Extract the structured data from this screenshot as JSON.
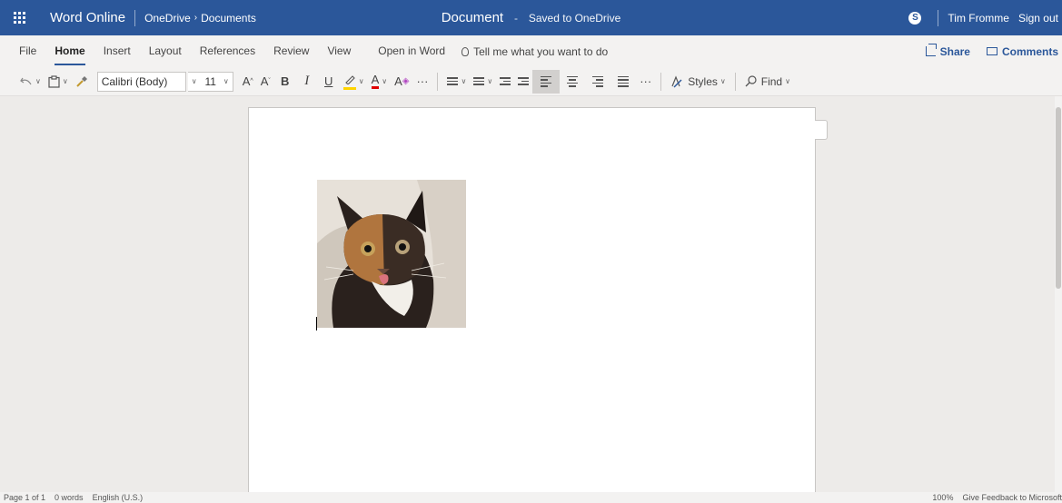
{
  "titlebar": {
    "app_name": "Word Online",
    "breadcrumb": {
      "parent": "OneDrive",
      "separator": "›",
      "current": "Documents"
    },
    "document_title": "Document",
    "separator": "-",
    "save_status": "Saved to OneDrive",
    "skype_icon_letter": "S",
    "user_name": "Tim Fromme",
    "sign_out": "Sign out",
    "color": "#2b579a"
  },
  "tabs": [
    {
      "label": "File",
      "active": false
    },
    {
      "label": "Home",
      "active": true
    },
    {
      "label": "Insert",
      "active": false
    },
    {
      "label": "Layout",
      "active": false
    },
    {
      "label": "References",
      "active": false
    },
    {
      "label": "Review",
      "active": false
    },
    {
      "label": "View",
      "active": false
    },
    {
      "label": "Open in Word",
      "active": false
    }
  ],
  "tell_me": "Tell me what you want to do",
  "share_label": "Share",
  "comments_label": "Comments",
  "ribbon": {
    "font_name": "Calibri (Body)",
    "font_size": "11",
    "grow_font": "A",
    "shrink_font": "A",
    "bold": "B",
    "italic": "I",
    "underline": "U",
    "font_color_glyph": "A",
    "clear_format_glyph": "A",
    "more": "···",
    "styles_label": "Styles",
    "find_label": "Find"
  },
  "image": {
    "description_icon": "cat-photo-icon"
  },
  "statusbar": {
    "page_info": "Page 1 of 1",
    "word_count": "0 words",
    "language": "English (U.S.)",
    "zoom": "100%",
    "feedback": "Give Feedback to Microsoft"
  }
}
